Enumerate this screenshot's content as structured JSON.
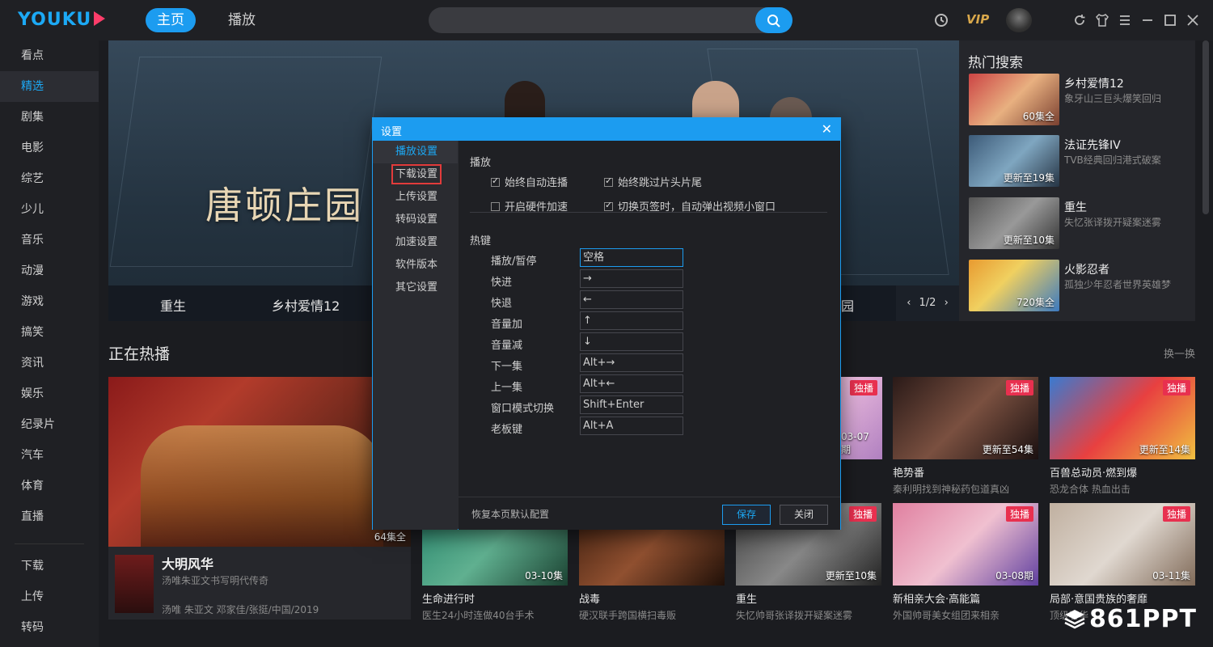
{
  "logo": "YOUKU",
  "nav": {
    "home": "主页",
    "play": "播放"
  },
  "topbar": {
    "vip": "VIP"
  },
  "sidebar": {
    "items": [
      "看点",
      "精选",
      "剧集",
      "电影",
      "综艺",
      "少儿",
      "音乐",
      "动漫",
      "游戏",
      "搞笑",
      "资讯",
      "娱乐",
      "纪录片",
      "汽车",
      "体育",
      "直播"
    ],
    "bottom": [
      "下载",
      "上传",
      "转码"
    ]
  },
  "banner": {
    "title": "唐顿庄园",
    "tabs": [
      "重生",
      "乡村爱情12",
      "园"
    ],
    "pager": "1/2"
  },
  "hot": {
    "title": "热门搜索",
    "items": [
      {
        "name": "乡村爱情12",
        "desc": "象牙山三巨头爆笑回归",
        "badge": "60集全"
      },
      {
        "name": "法证先锋IV",
        "desc": "TVB经典回归港式破案",
        "badge": "更新至19集"
      },
      {
        "name": "重生",
        "desc": "失忆张译拨开疑案迷雾",
        "badge": "更新至10集"
      },
      {
        "name": "火影忍者",
        "desc": "孤独少年忍者世界英雄梦",
        "badge": "720集全"
      }
    ]
  },
  "section": {
    "title": "正在热播",
    "more": "换一换"
  },
  "feature": {
    "name": "大明风华",
    "desc": "汤唯朱亚文书写明代传奇",
    "meta": "汤唯 朱亚文 邓家佳/张挺/中国/2019",
    "badge": "64集全"
  },
  "cards": [
    {
      "name": "艳势番",
      "desc": "秦利明找到神秘药包道真凶",
      "badge": "更新至54集",
      "exclusive": "独播"
    },
    {
      "name": "百兽总动员·燃到爆",
      "desc": "恐龙合体 热血出击",
      "badge": "更新至14集",
      "exclusive": "独播"
    },
    {
      "name": "生命进行时",
      "desc": "医生24小时连做40台手术",
      "badge": "03-10集",
      "exclusive": ""
    },
    {
      "name": "战毒",
      "desc": "硬汉联手跨国横扫毒贩",
      "badge": "",
      "exclusive": ""
    },
    {
      "name": "重生",
      "desc": "失忆帅哥张译拨开疑案迷雾",
      "badge": "更新至10集",
      "exclusive": "独播"
    },
    {
      "name": "新相亲大会·高能篇",
      "desc": "外国帅哥美女组团来相亲",
      "badge": "03-08期",
      "exclusive": "独播"
    },
    {
      "name": "局部·意国贵族的奢靡",
      "desc": "顶级奢华",
      "badge": "03-11集",
      "exclusive": "独播"
    }
  ],
  "partial_card": {
    "badge": "03-07期",
    "exclusive": "独播"
  },
  "watermark": "861PPT",
  "dialog": {
    "title": "设置",
    "close": "✕",
    "nav": [
      "播放设置",
      "下载设置",
      "上传设置",
      "转码设置",
      "加速设置",
      "软件版本",
      "其它设置"
    ],
    "play_group": "播放",
    "checkboxes": [
      {
        "label": "始终自动连播",
        "checked": true
      },
      {
        "label": "始终跳过片头片尾",
        "checked": true
      },
      {
        "label": "开启硬件加速",
        "checked": false
      },
      {
        "label": "切换页签时，自动弹出视频小窗口",
        "checked": true
      }
    ],
    "hotkey_group": "热键",
    "hotkeys": [
      {
        "label": "播放/暂停",
        "value": "空格"
      },
      {
        "label": "快进",
        "value": "→"
      },
      {
        "label": "快退",
        "value": "←"
      },
      {
        "label": "音量加",
        "value": "↑"
      },
      {
        "label": "音量减",
        "value": "↓"
      },
      {
        "label": "下一集",
        "value": "Alt+→"
      },
      {
        "label": "上一集",
        "value": "Alt+←"
      },
      {
        "label": "窗口模式切换",
        "value": "Shift+Enter"
      },
      {
        "label": "老板键",
        "value": "Alt+A"
      }
    ],
    "reset": "恢复本页默认配置",
    "save": "保存",
    "close_btn": "关闭"
  },
  "colors": {
    "accent": "#1c9cf0",
    "exclusive": "#e8304f",
    "vip": "#d9a84b",
    "mark": "#e23b3b"
  }
}
